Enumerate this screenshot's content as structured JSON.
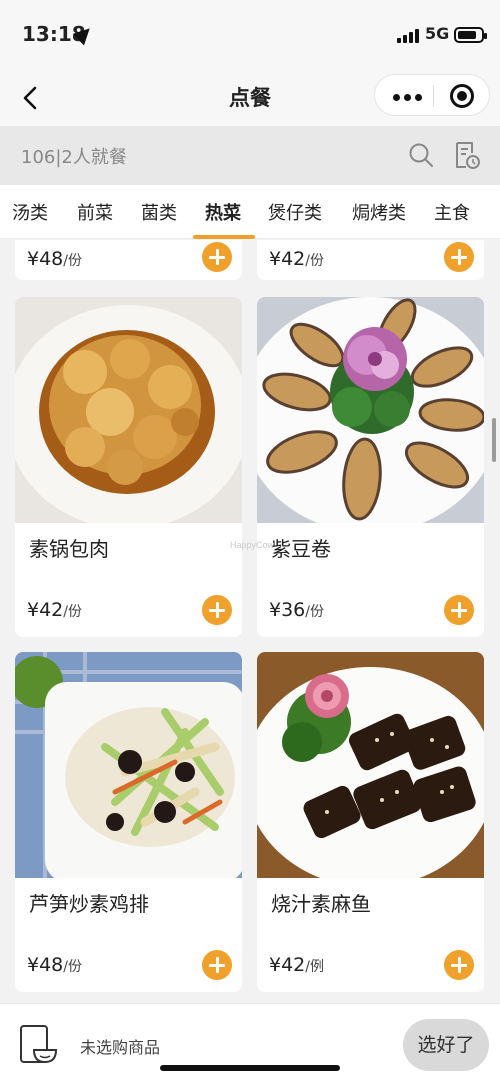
{
  "status_bar": {
    "time": "13:18",
    "network": "5G"
  },
  "nav": {
    "title": "点餐"
  },
  "table_bar": {
    "text": "106|2人就餐"
  },
  "tabs": [
    {
      "label": "汤类"
    },
    {
      "label": "前菜"
    },
    {
      "label": "菌类"
    },
    {
      "label": "热菜",
      "active": true
    },
    {
      "label": "煲仔类"
    },
    {
      "label": "焗烤类"
    },
    {
      "label": "主食"
    }
  ],
  "items": [
    {
      "name": "",
      "currency": "¥",
      "price": "48",
      "unit": "/份"
    },
    {
      "name": "",
      "currency": "¥",
      "price": "42",
      "unit": "/份"
    },
    {
      "name": "素锅包肉",
      "currency": "¥",
      "price": "42",
      "unit": "/份"
    },
    {
      "name": "紫豆卷",
      "currency": "¥",
      "price": "36",
      "unit": "/份"
    },
    {
      "name": "芦笋炒素鸡排",
      "currency": "¥",
      "price": "48",
      "unit": "/份"
    },
    {
      "name": "烧汁素麻鱼",
      "currency": "¥",
      "price": "42",
      "unit": "/例"
    }
  ],
  "watermark": "HappyCow",
  "bottom_bar": {
    "cart_text": "未选购商品",
    "done_label": "选好了"
  },
  "colors": {
    "accent": "#f0a12c",
    "background": "#f2f2f2"
  },
  "icons": [
    "location-arrow-icon",
    "signal-icon",
    "battery-icon",
    "back-icon",
    "more-icon",
    "target-icon",
    "search-icon",
    "orders-icon",
    "plus-icon",
    "cart-icon"
  ]
}
